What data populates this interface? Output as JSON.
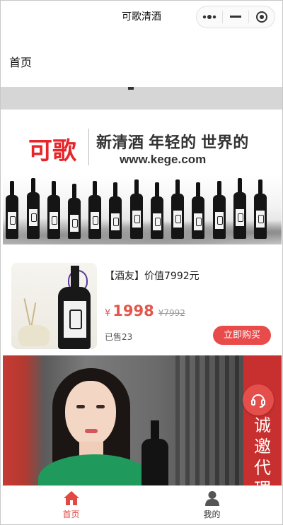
{
  "titlebar": {
    "title": "可歌清酒"
  },
  "header": {
    "title": "首页"
  },
  "banner": {
    "brand": "可歌",
    "slogan": "新清酒 年轻的 世界的",
    "site": "www.kege.com"
  },
  "product": {
    "name": "【酒友】价值7992元",
    "currency": "¥",
    "price": "1998",
    "original_price": "¥7992",
    "sold": "已售23",
    "buy_label": "立即购买"
  },
  "promo": {
    "invite_text": "诚邀代理"
  },
  "tabbar": {
    "items": [
      {
        "label": "首页",
        "icon": "home-icon",
        "active": true
      },
      {
        "label": "我的",
        "icon": "user-icon",
        "active": false
      }
    ]
  },
  "colors": {
    "accent": "#e14a43",
    "price": "#e2574c",
    "button": "#e94b4b",
    "promo_bar": "#c8302f"
  }
}
